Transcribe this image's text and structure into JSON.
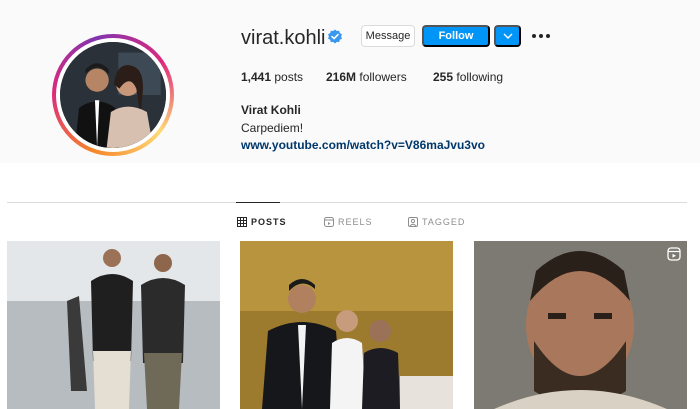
{
  "profile": {
    "username": "virat.kohli",
    "full_name": "Virat Kohli",
    "bio": "Carpediem!",
    "link": "www.youtube.com/watch?v=V86maJvu3vo"
  },
  "buttons": {
    "message": "Message",
    "follow": "Follow"
  },
  "stats": {
    "posts_count": "1,441",
    "posts_label": "posts",
    "followers_count": "216M",
    "followers_label": "followers",
    "following_count": "255",
    "following_label": "following"
  },
  "tabs": [
    {
      "label": "POSTS",
      "icon": "grid-icon",
      "active": true
    },
    {
      "label": "REELS",
      "icon": "reels-icon",
      "active": false
    },
    {
      "label": "TAGGED",
      "icon": "tagged-icon",
      "active": false
    }
  ],
  "colors": {
    "accent": "#0095f6",
    "link": "#00376b",
    "verified": "#3897f0"
  }
}
